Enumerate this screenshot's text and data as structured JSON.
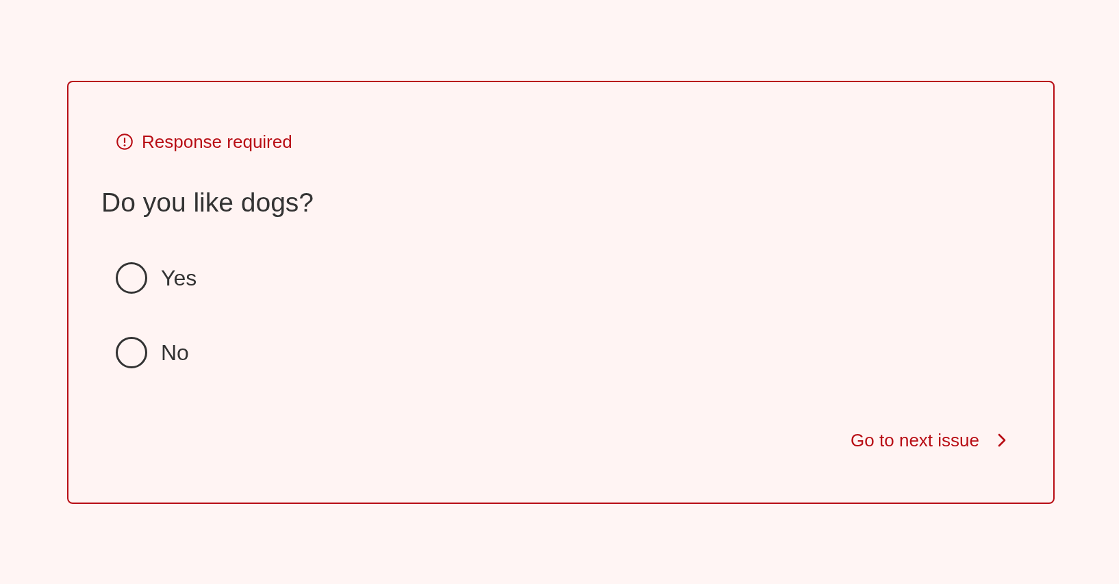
{
  "question": {
    "error": {
      "message": "Response required"
    },
    "text": "Do you like dogs?",
    "options": [
      {
        "label": "Yes",
        "selected": false
      },
      {
        "label": "No",
        "selected": false
      }
    ],
    "next_issue_link": "Go to next issue"
  }
}
